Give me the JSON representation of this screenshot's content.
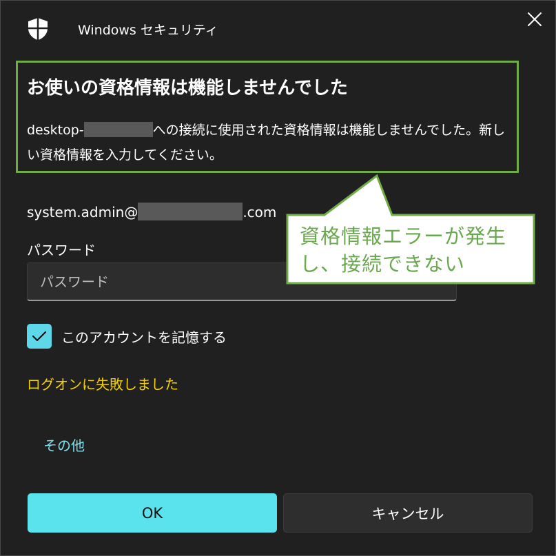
{
  "window": {
    "title": "Windows セキュリティ"
  },
  "dialog": {
    "heading": "お使いの資格情報は機能しませんでした",
    "message_prefix": "desktop-",
    "message_suffix": "への接続に使用された資格情報は機能しませんでした。新しい資格情報を入力してください。"
  },
  "account": {
    "email_prefix": "system.admin@",
    "email_suffix": ".com"
  },
  "password": {
    "label": "パスワード",
    "placeholder": "パスワード",
    "value": ""
  },
  "remember": {
    "label": "このアカウントを記憶する",
    "checked": true
  },
  "error": {
    "text": "ログオンに失敗しました"
  },
  "more_link": {
    "label": "その他"
  },
  "buttons": {
    "ok": "OK",
    "cancel": "キャンセル"
  },
  "annotation": {
    "text": "資格情報エラーが発生し、接続できない"
  },
  "icons": {
    "title": "shield-icon",
    "close": "close-icon",
    "check": "checkmark-icon"
  },
  "colors": {
    "background": "#202020",
    "accent": "#5ae3ec",
    "error": "#f5d000",
    "link": "#7ee0ec",
    "annotation_green": "#70ad47"
  }
}
